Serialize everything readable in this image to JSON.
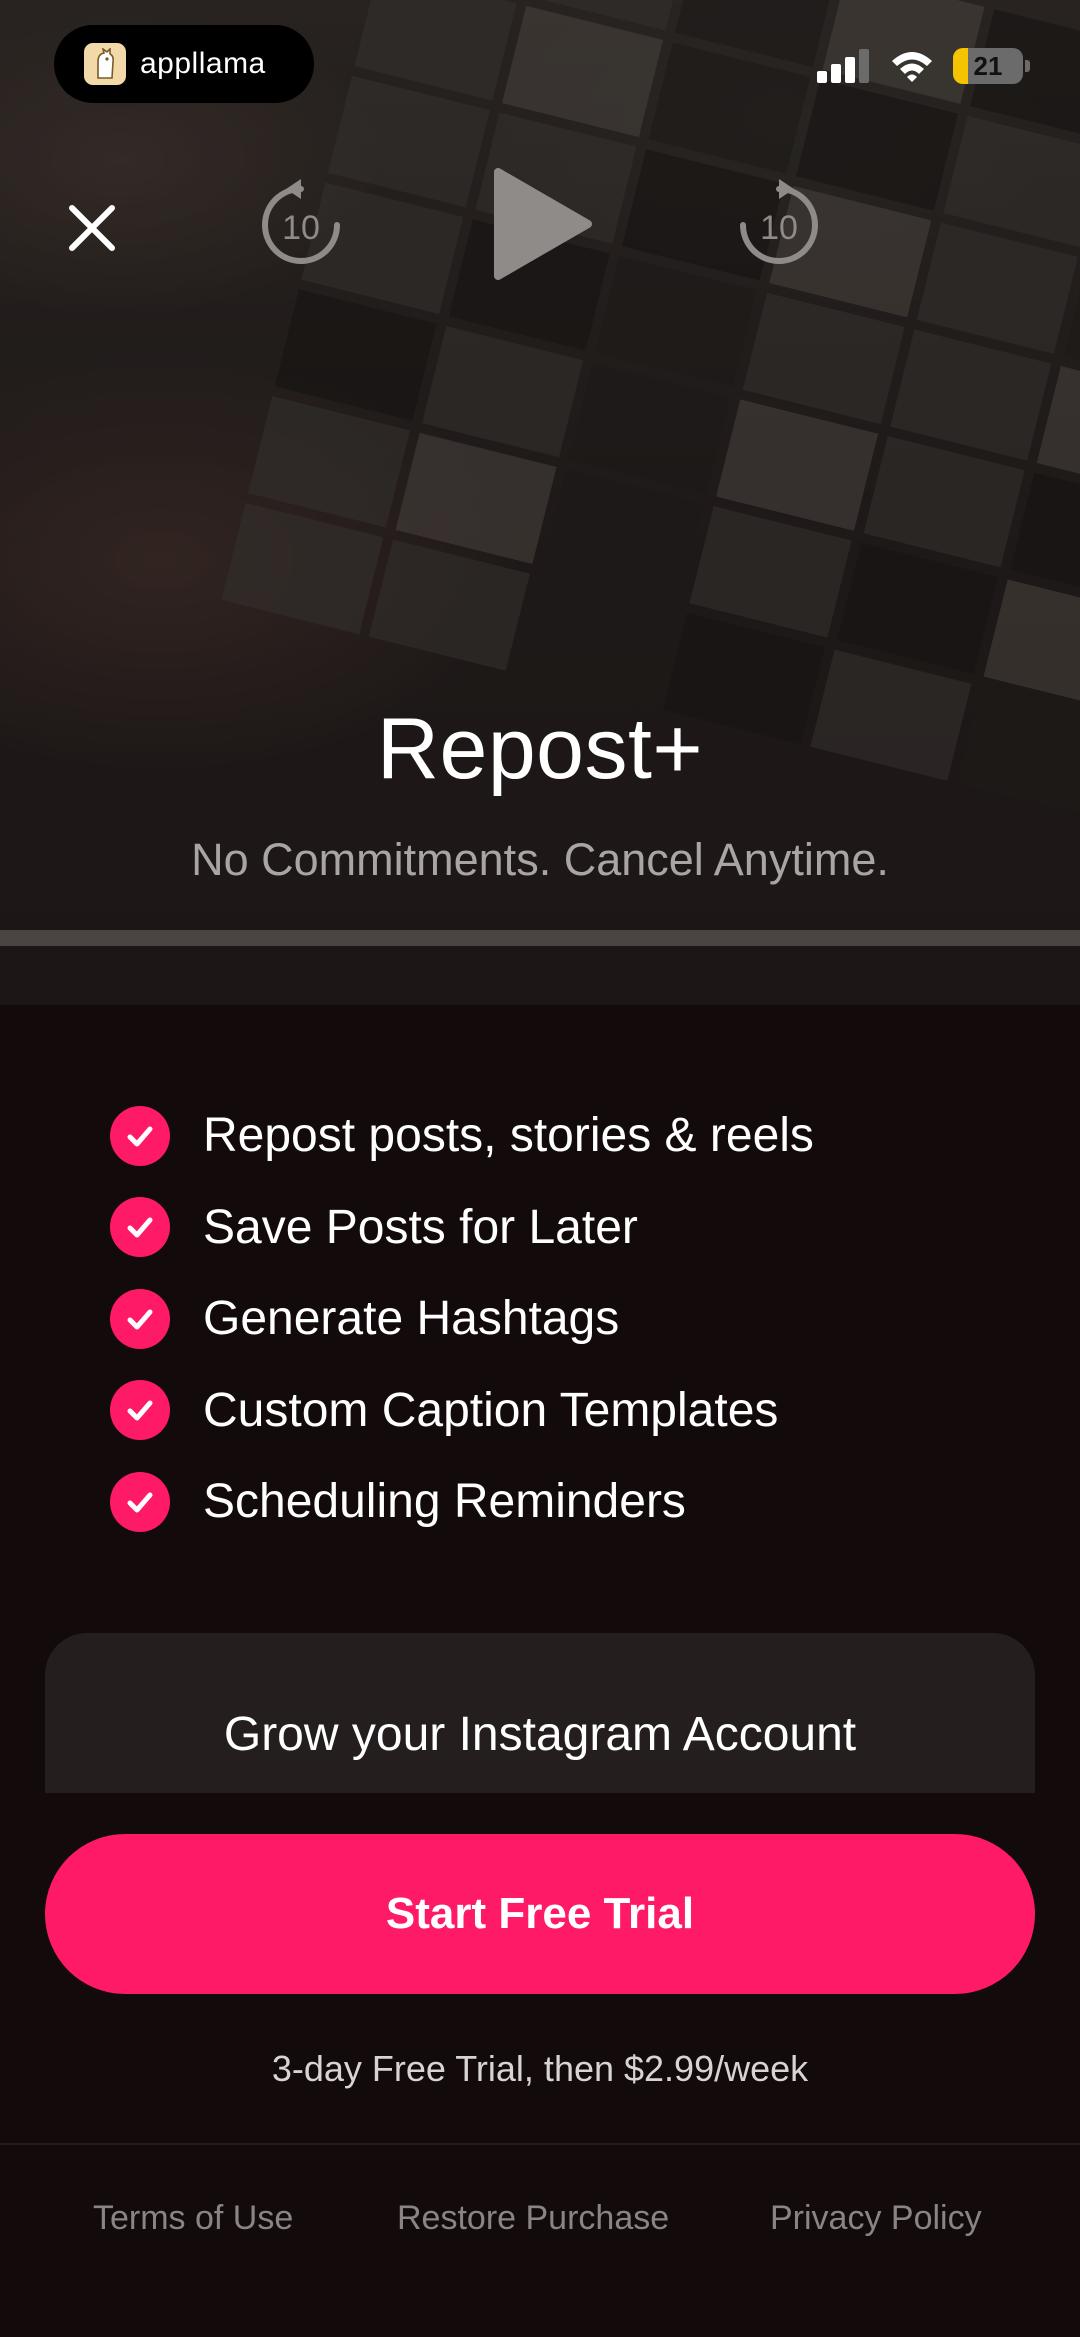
{
  "status_bar": {
    "brand": "appllama",
    "battery": "21",
    "battery_level": 0.21
  },
  "player": {
    "rewind_seconds": "10",
    "forward_seconds": "10"
  },
  "header": {
    "title": "Repost+",
    "subtitle": "No Commitments. Cancel Anytime."
  },
  "features": [
    "Repost posts, stories & reels",
    "Save Posts for Later",
    "Generate Hashtags",
    "Custom Caption Templates",
    "Scheduling Reminders"
  ],
  "promo": {
    "title": "Grow your Instagram Account"
  },
  "cta": {
    "label": "Start Free Trial",
    "trial_text": "3-day Free Trial, then $2.99/week"
  },
  "footer": {
    "terms": "Terms of Use",
    "restore": "Restore Purchase",
    "privacy": "Privacy Policy"
  },
  "colors": {
    "accent": "#ff1a68",
    "background": "#120a0b",
    "card": "#241e1e"
  }
}
